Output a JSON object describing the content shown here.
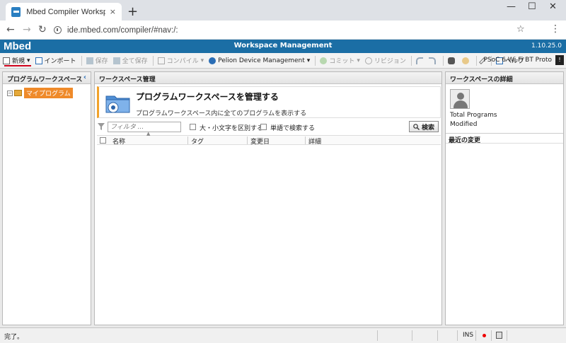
{
  "browser": {
    "tab_title": "Mbed Compiler Workspace Mana",
    "tab_close": "×",
    "new_tab": "+",
    "url": "ide.mbed.com/compiler/#nav:/:",
    "back": "←",
    "forward": "→",
    "reload": "↻",
    "star": "☆",
    "menu": "⋮",
    "minimize": "—",
    "maximize": "☐",
    "close": "✕"
  },
  "app": {
    "logo": "Mbed",
    "title": "Workspace Management",
    "version": "1.10.25.0"
  },
  "toolbar": {
    "new": "新規",
    "new_caret": "▾",
    "import": "インポート",
    "save": "保存",
    "save_all": "全て保存",
    "compile": "コンパイル",
    "compile_caret": "▾",
    "pelion": "Pelion Device Management",
    "pelion_caret": "▾",
    "commit": "コミット",
    "commit_caret": "▾",
    "revision": "リビジョン",
    "help": "ヘルプ",
    "target": "PSoC 6 Wi-Fi BT Proto",
    "target_arrow": "!"
  },
  "left_panel": {
    "title": "プログラムワークスペース",
    "collapse": "‹",
    "tree_expander": "−",
    "root_label": "マイプログラム"
  },
  "center_panel": {
    "title": "ワークスペース管理",
    "banner_title": "プログラムワークスペースを管理する",
    "banner_subtitle": "プログラムワークスペース内に全てのプログラムを表示する",
    "filter_placeholder": "フィルタ ...",
    "case_sensitive": "大・小文字を区別する",
    "whole_word": "単語で検索する",
    "search_button": "検索",
    "sort_arrow": "▲",
    "columns": [
      "名称",
      "タグ",
      "変更日",
      "詳細"
    ]
  },
  "right_panel": {
    "title": "ワークスペースの詳細",
    "total_programs": "Total Programs",
    "modified": "Modified",
    "recent_changes": "最近の変更"
  },
  "statusbar": {
    "text": "完了。",
    "ins": "INS"
  }
}
